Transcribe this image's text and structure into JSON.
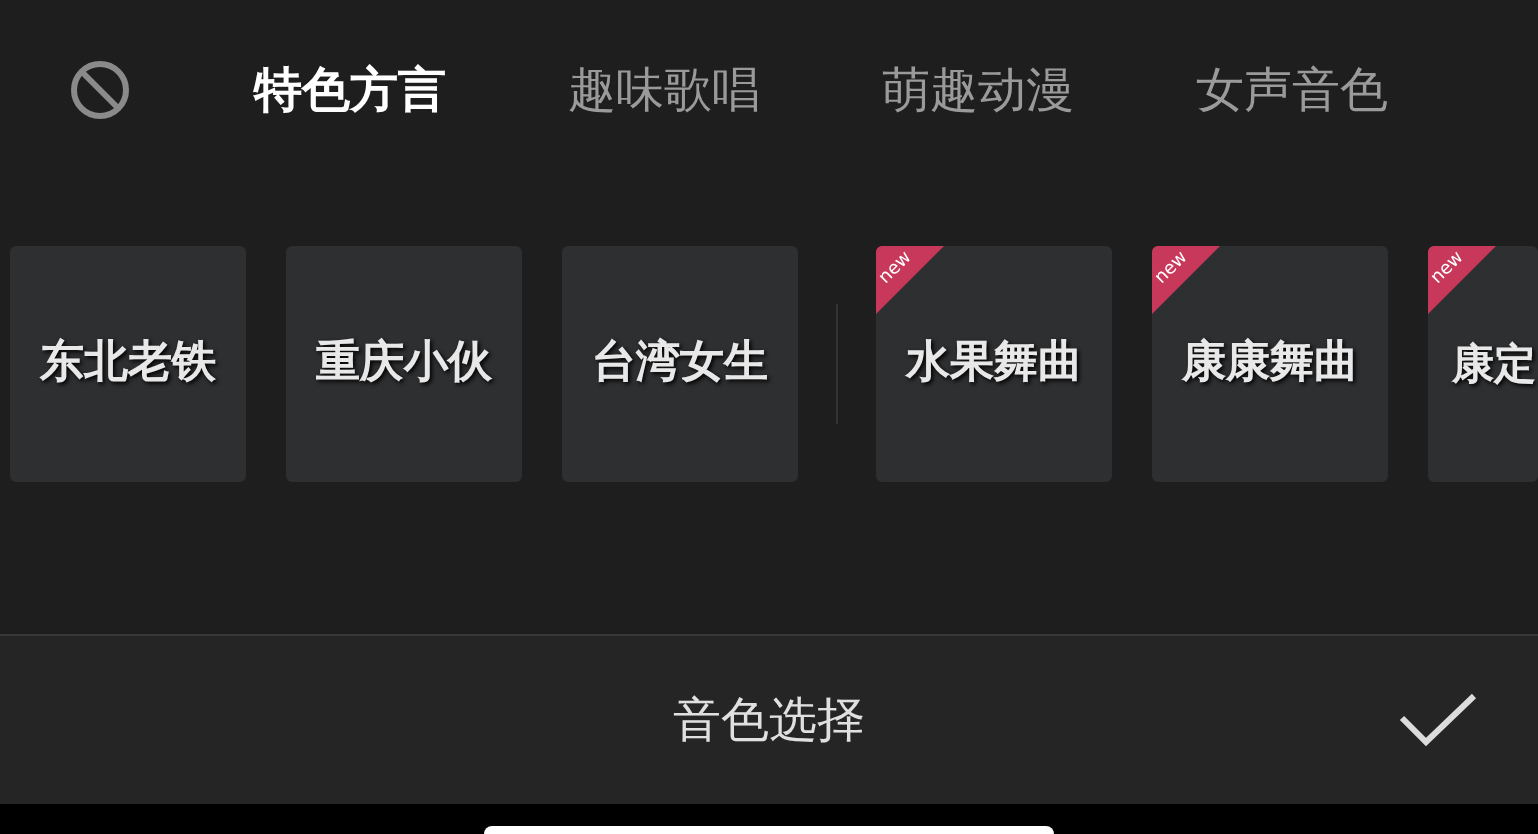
{
  "tabs": [
    {
      "label": "特色方言",
      "selected": true
    },
    {
      "label": "趣味歌唱",
      "selected": false
    },
    {
      "label": "萌趣动漫",
      "selected": false
    },
    {
      "label": "女声音色",
      "selected": false
    }
  ],
  "voice_groups": [
    {
      "cards": [
        {
          "label": "东北老铁"
        },
        {
          "label": "重庆小伙"
        },
        {
          "label": "台湾女生"
        }
      ]
    },
    {
      "cards": [
        {
          "label": "水果舞曲",
          "badge": "new"
        },
        {
          "label": "康康舞曲",
          "badge": "new"
        },
        {
          "label": "康定",
          "badge": "new"
        }
      ]
    }
  ],
  "footer": {
    "title": "音色选择"
  }
}
